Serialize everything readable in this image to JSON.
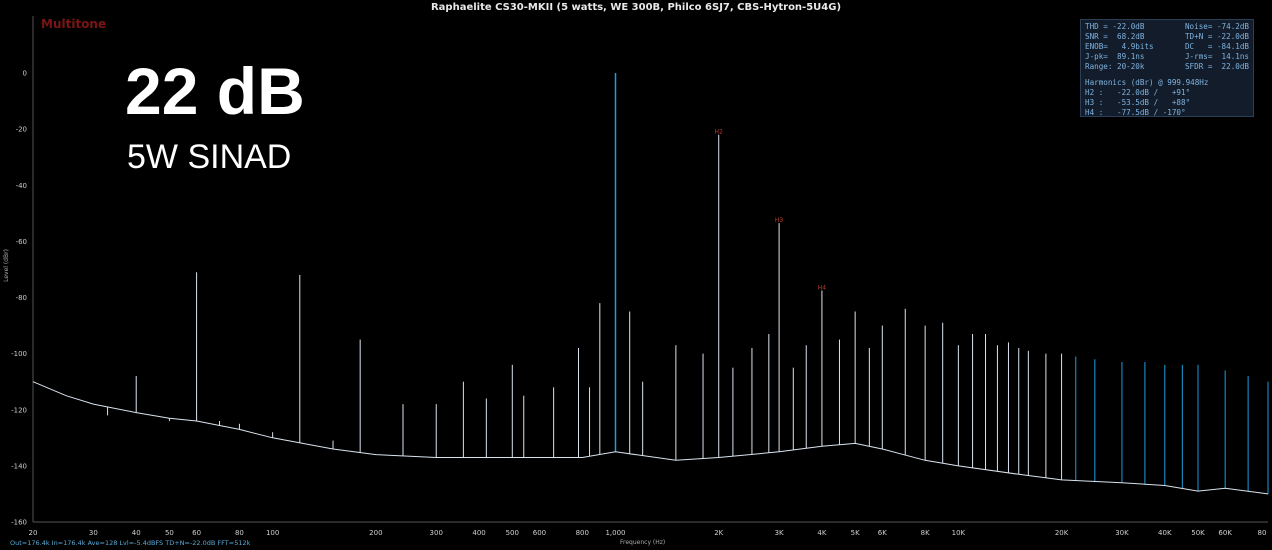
{
  "title": "Raphaelite CS30-MKII (5 watts, WE 300B, Philco 6SJ7, CBS-Hytron-5U4G)",
  "brand": "Multitone",
  "headline": {
    "value": "22 dB",
    "subtitle": "5W SINAD"
  },
  "footer": "Out=176.4k In=176.4k Ave=128 Lvl=-5.4dBFS TD+N=-22.0dB FFT=512k",
  "colors": {
    "trace": "#d9e3ee",
    "highlight": "#1e9de0",
    "harmonic_label": "#c0392b",
    "brand": "#7a1515"
  },
  "stats": {
    "rows": [
      [
        "THD = -22.0dB",
        "Noise= -74.2dB"
      ],
      [
        "SNR =  68.2dB",
        "TD+N = -22.0dB"
      ],
      [
        "ENOB=   4.9bits",
        "DC   = -84.1dB"
      ],
      [
        "J-pk=  89.1ns",
        "J-rms=  14.1ns"
      ],
      [
        "Range: 20-20k",
        "SFDR =  22.0dB"
      ]
    ],
    "harmonics_header": "Harmonics (dBr) @ 999.948Hz",
    "harmonics": [
      "H2 :   -22.0dB /   +91°",
      "H3 :   -53.5dB /   +88°",
      "H4 :   -77.5dB / -170°"
    ]
  },
  "chart_data": {
    "type": "line",
    "title": "Raphaelite CS30-MKII (5 watts, WE 300B, Philco 6SJ7, CBS-Hytron-5U4G)",
    "xlabel": "Frequency (Hz)",
    "ylabel": "Level (dBr)",
    "x_scale": "log",
    "xlim": [
      20,
      80000
    ],
    "ylim": [
      -160,
      0
    ],
    "x_ticks": [
      {
        "v": 20,
        "label": "20"
      },
      {
        "v": 30,
        "label": "30"
      },
      {
        "v": 40,
        "label": "40"
      },
      {
        "v": 50,
        "label": "50"
      },
      {
        "v": 60,
        "label": "60"
      },
      {
        "v": 80,
        "label": "80"
      },
      {
        "v": 100,
        "label": "100"
      },
      {
        "v": 200,
        "label": "200"
      },
      {
        "v": 300,
        "label": "300"
      },
      {
        "v": 400,
        "label": "400"
      },
      {
        "v": 500,
        "label": "500"
      },
      {
        "v": 600,
        "label": "600"
      },
      {
        "v": 800,
        "label": "800"
      },
      {
        "v": 1000,
        "label": "1,000"
      },
      {
        "v": 2000,
        "label": "2K"
      },
      {
        "v": 3000,
        "label": "3K"
      },
      {
        "v": 4000,
        "label": "4K"
      },
      {
        "v": 5000,
        "label": "5K"
      },
      {
        "v": 6000,
        "label": "6K"
      },
      {
        "v": 8000,
        "label": "8K"
      },
      {
        "v": 10000,
        "label": "10K"
      },
      {
        "v": 20000,
        "label": "20K"
      },
      {
        "v": 30000,
        "label": "30K"
      },
      {
        "v": 40000,
        "label": "40K"
      },
      {
        "v": 50000,
        "label": "50K"
      },
      {
        "v": 60000,
        "label": "60K"
      },
      {
        "v": 80000,
        "label": "80"
      }
    ],
    "y_ticks": [
      0,
      -20,
      -40,
      -60,
      -80,
      -100,
      -120,
      -140,
      -160
    ],
    "noise_floor": [
      [
        20,
        -110
      ],
      [
        25,
        -115
      ],
      [
        30,
        -118
      ],
      [
        40,
        -121
      ],
      [
        50,
        -123
      ],
      [
        60,
        -124
      ],
      [
        80,
        -127
      ],
      [
        100,
        -130
      ],
      [
        150,
        -134
      ],
      [
        200,
        -136
      ],
      [
        300,
        -137
      ],
      [
        500,
        -137
      ],
      [
        800,
        -137
      ],
      [
        1000,
        -135
      ],
      [
        1500,
        -138
      ],
      [
        2000,
        -137
      ],
      [
        3000,
        -135
      ],
      [
        4000,
        -133
      ],
      [
        5000,
        -132
      ],
      [
        6000,
        -134
      ],
      [
        8000,
        -138
      ],
      [
        10000,
        -140
      ],
      [
        15000,
        -143
      ],
      [
        20000,
        -145
      ],
      [
        30000,
        -146
      ],
      [
        40000,
        -147
      ],
      [
        50000,
        -149
      ],
      [
        60000,
        -148
      ],
      [
        80000,
        -150
      ]
    ],
    "spurs": [
      [
        33,
        -122
      ],
      [
        40,
        -108
      ],
      [
        50,
        -124
      ],
      [
        60,
        -71
      ],
      [
        70,
        -124
      ],
      [
        80,
        -125
      ],
      [
        100,
        -128
      ],
      [
        120,
        -72
      ],
      [
        150,
        -131
      ],
      [
        180,
        -95
      ],
      [
        240,
        -118
      ],
      [
        300,
        -118
      ],
      [
        360,
        -110
      ],
      [
        420,
        -116
      ],
      [
        500,
        -104
      ],
      [
        540,
        -115
      ],
      [
        660,
        -112
      ],
      [
        780,
        -98
      ],
      [
        840,
        -112
      ],
      [
        900,
        -82
      ],
      [
        1000,
        0
      ],
      [
        1100,
        -85
      ],
      [
        1200,
        -110
      ],
      [
        1500,
        -97
      ],
      [
        1800,
        -100
      ],
      [
        2000,
        -22
      ],
      [
        2200,
        -105
      ],
      [
        2500,
        -98
      ],
      [
        2800,
        -93
      ],
      [
        3000,
        -53.5
      ],
      [
        3300,
        -105
      ],
      [
        3600,
        -97
      ],
      [
        4000,
        -77.5
      ],
      [
        4500,
        -95
      ],
      [
        5000,
        -85
      ],
      [
        5500,
        -98
      ],
      [
        6000,
        -90
      ],
      [
        7000,
        -84
      ],
      [
        8000,
        -90
      ],
      [
        9000,
        -89
      ],
      [
        10000,
        -97
      ],
      [
        11000,
        -93
      ],
      [
        12000,
        -93
      ],
      [
        13000,
        -97
      ],
      [
        14000,
        -96
      ],
      [
        15000,
        -98
      ],
      [
        16000,
        -99
      ],
      [
        18000,
        -100
      ],
      [
        20000,
        -100
      ],
      [
        22000,
        -101
      ],
      [
        25000,
        -102
      ],
      [
        30000,
        -103
      ],
      [
        35000,
        -103
      ],
      [
        40000,
        -104
      ],
      [
        45000,
        -104
      ],
      [
        50000,
        -104
      ],
      [
        60000,
        -106
      ],
      [
        70000,
        -108
      ],
      [
        80000,
        -110
      ]
    ],
    "harmonic_markers": [
      {
        "x": 2000,
        "y": -22,
        "label": "H2"
      },
      {
        "x": 3000,
        "y": -53.5,
        "label": "H3"
      },
      {
        "x": 4000,
        "y": -77.5,
        "label": "H4"
      }
    ],
    "highlight_above_hz": 20000,
    "grid": false
  }
}
